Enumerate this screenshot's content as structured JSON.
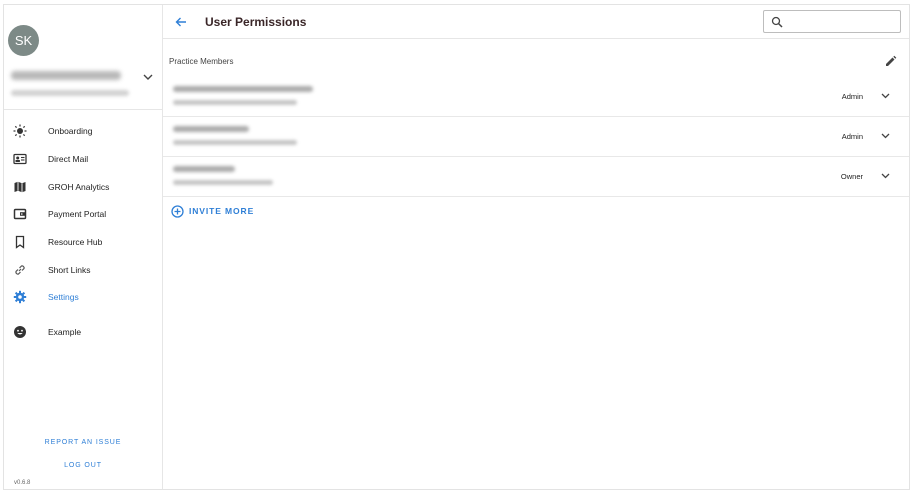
{
  "colors": {
    "accent": "#2f7fd6",
    "avatar_bg": "#7d8a87",
    "title": "#3a2628"
  },
  "account": {
    "initials": "SK",
    "chevron_icon": "chevron-down-icon"
  },
  "sidebar": {
    "items": [
      {
        "label": "Onboarding",
        "icon": "sun-icon",
        "active": false
      },
      {
        "label": "Direct Mail",
        "icon": "contact-card-icon",
        "active": false
      },
      {
        "label": "GROH Analytics",
        "icon": "map-icon",
        "active": false
      },
      {
        "label": "Payment Portal",
        "icon": "wallet-icon",
        "active": false
      },
      {
        "label": "Resource Hub",
        "icon": "bookmark-icon",
        "active": false
      },
      {
        "label": "Short Links",
        "icon": "link-icon",
        "active": false
      },
      {
        "label": "Settings",
        "icon": "gear-icon",
        "active": true
      },
      {
        "label": "Example",
        "icon": "smiley-icon",
        "active": false
      }
    ],
    "report_issue": "REPORT AN ISSUE",
    "logout": "LOG OUT",
    "version": "v0.6.8"
  },
  "header": {
    "title": "User Permissions",
    "search": {
      "placeholder": "",
      "value": ""
    }
  },
  "members": {
    "section_label": "Practice Members",
    "rows": [
      {
        "role": "Admin"
      },
      {
        "role": "Admin"
      },
      {
        "role": "Owner"
      }
    ],
    "invite_label": "INVITE MORE"
  }
}
